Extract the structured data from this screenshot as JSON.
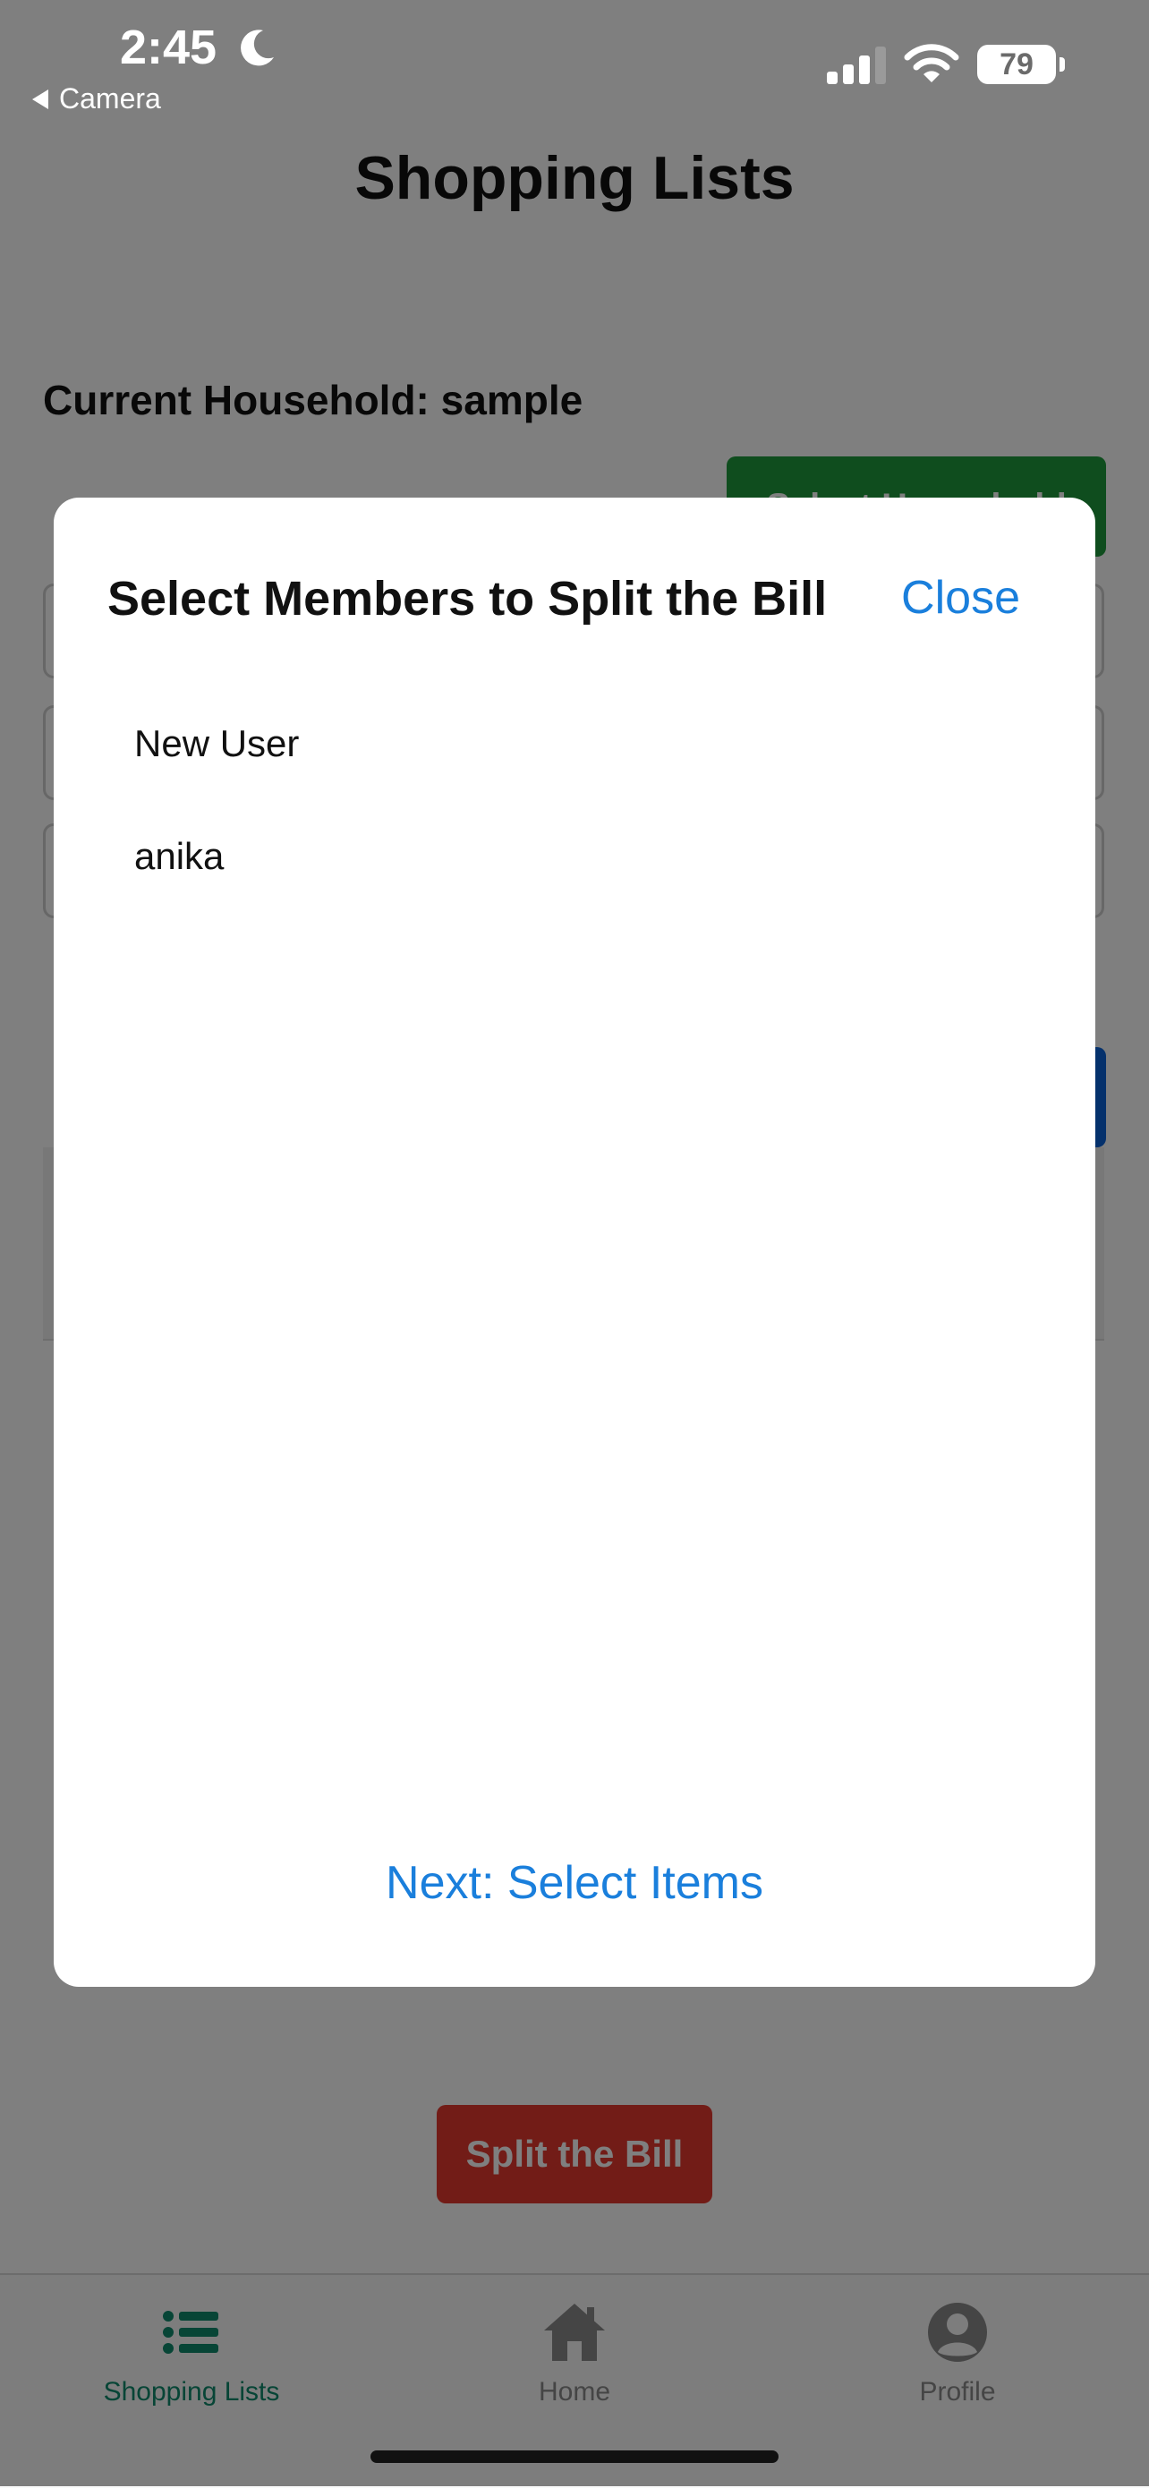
{
  "status_bar": {
    "time": "2:45",
    "back_app": "Camera",
    "battery": "79"
  },
  "page": {
    "title": "Shopping Lists",
    "household_label": "Current Household: sample",
    "select_household_label": "Select Household",
    "split_bill_label": "Split the Bill"
  },
  "modal": {
    "title": "Select Members to Split the Bill",
    "close_label": "Close",
    "members": [
      {
        "name": "New User"
      },
      {
        "name": "anika"
      }
    ],
    "next_label": "Next: Select Items"
  },
  "tab_bar": {
    "tabs": [
      {
        "label": "Shopping Lists",
        "icon": "list-icon",
        "active": true
      },
      {
        "label": "Home",
        "icon": "home-icon",
        "active": false
      },
      {
        "label": "Profile",
        "icon": "profile-icon",
        "active": false
      }
    ]
  },
  "colors": {
    "accent_blue": "#1a7fdc",
    "active_tab": "#0e8a6c",
    "green_button": "#1f9a3c",
    "red_button": "#e5392e"
  }
}
